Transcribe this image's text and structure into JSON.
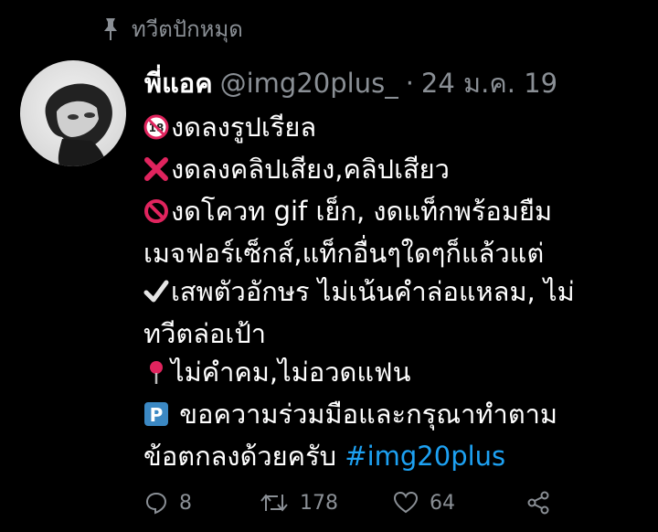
{
  "pinned": {
    "label": "ทวีตปักหมุด",
    "icon": "pin-icon"
  },
  "tweet": {
    "author_name": "พี่แอค",
    "handle": "@img20plus_",
    "separator": "·",
    "date": "24 ม.ค. 19",
    "lines": [
      "งดลงรูปเรียล",
      "งดลงคลิปเสียง,คลิปเสียว",
      "งดโควท gif เย็ก, งดแท็กพร้อมยืม",
      "เมจฟอร์เซ็กส์,แท็กอื่นๆใดๆก็แล้วแต่",
      "เสพตัวอักษร ไม่เน้นคำล่อแหลม, ไม่",
      "ทวีตล่อเป้า",
      "ไม่คำคม,ไม่อวดแฟน",
      " ขอความร่วมมือและกรุณาทำตาม",
      "ข้อตกลงด้วยครับ "
    ],
    "hashtag": "#img20plus",
    "emoji_icons": [
      "no-under-18-icon",
      "cross-mark-icon",
      "prohibited-icon",
      "check-mark-icon",
      "round-pushpin-icon",
      "p-button-icon"
    ],
    "actions": {
      "reply_count": "8",
      "retweet_count": "178",
      "like_count": "64"
    }
  },
  "colors": {
    "background": "#000000",
    "text": "#ffffff",
    "secondary": "#8a8f95",
    "link": "#1da1f2"
  }
}
